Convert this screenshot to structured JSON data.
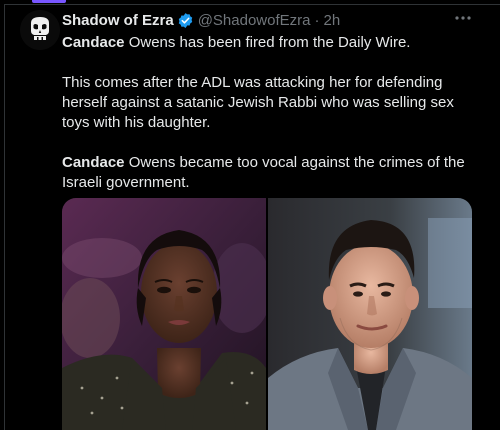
{
  "tweet": {
    "author": {
      "display_name": "Shadow of Ezra",
      "handle": "@ShadowofEzra",
      "avatar_icon": "punisher-skull-icon",
      "verified": true
    },
    "separator": "·",
    "time": "2h",
    "more_icon": "more-options-icon",
    "body": {
      "p1_name": "Candace",
      "p1_rest": " Owens has been fired from the Daily Wire.",
      "p2": "This comes after the ADL was attacking her for defending herself against a satanic Jewish Rabbi who was selling sex toys with his daughter.",
      "p3_name": "Candace",
      "p3_rest": " Owens became too vocal against the crimes of the Israeli government."
    },
    "media": [
      {
        "kind": "photo",
        "subject": "woman-portrait"
      },
      {
        "kind": "photo",
        "subject": "man-portrait"
      }
    ]
  },
  "colors": {
    "background": "#000000",
    "text": "#e7e9ea",
    "muted": "#71767b",
    "verified": "#1d9bf0",
    "accent": "#7856ff"
  }
}
